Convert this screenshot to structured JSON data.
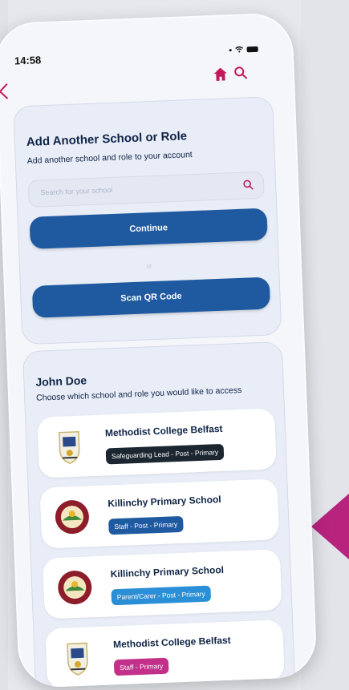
{
  "status": {
    "time": "14:58"
  },
  "header": {
    "back_icon": "chevron-left-icon",
    "home_icon": "home-icon",
    "search_icon": "search-icon",
    "accent": "#c2185b"
  },
  "add_school": {
    "title": "Add Another School or Role",
    "subtitle": "Add another school and role to your account",
    "search_placeholder": "Search for your school",
    "continue_label": "Continue",
    "separator": "or",
    "scan_label": "Scan QR Code",
    "button_color": "#1f5aa0"
  },
  "user": {
    "name": "John Doe",
    "prompt": "Choose which school and role you would like to access"
  },
  "schools": [
    {
      "name": "Methodist College Belfast",
      "role": "Safeguarding Lead - Post - Primary",
      "badge_color": "#1c2630",
      "logo": "crest"
    },
    {
      "name": "Killinchy Primary School",
      "role": "Staff - Post - Primary",
      "badge_color": "#1f5aa0",
      "logo": "round"
    },
    {
      "name": "Killinchy Primary School",
      "role": "Parent/Carer - Post - Primary",
      "badge_color": "#2a8fd6",
      "logo": "round"
    },
    {
      "name": "Methodist College Belfast",
      "role": "Staff - Primary",
      "badge_color": "#c2308a",
      "logo": "crest"
    }
  ]
}
